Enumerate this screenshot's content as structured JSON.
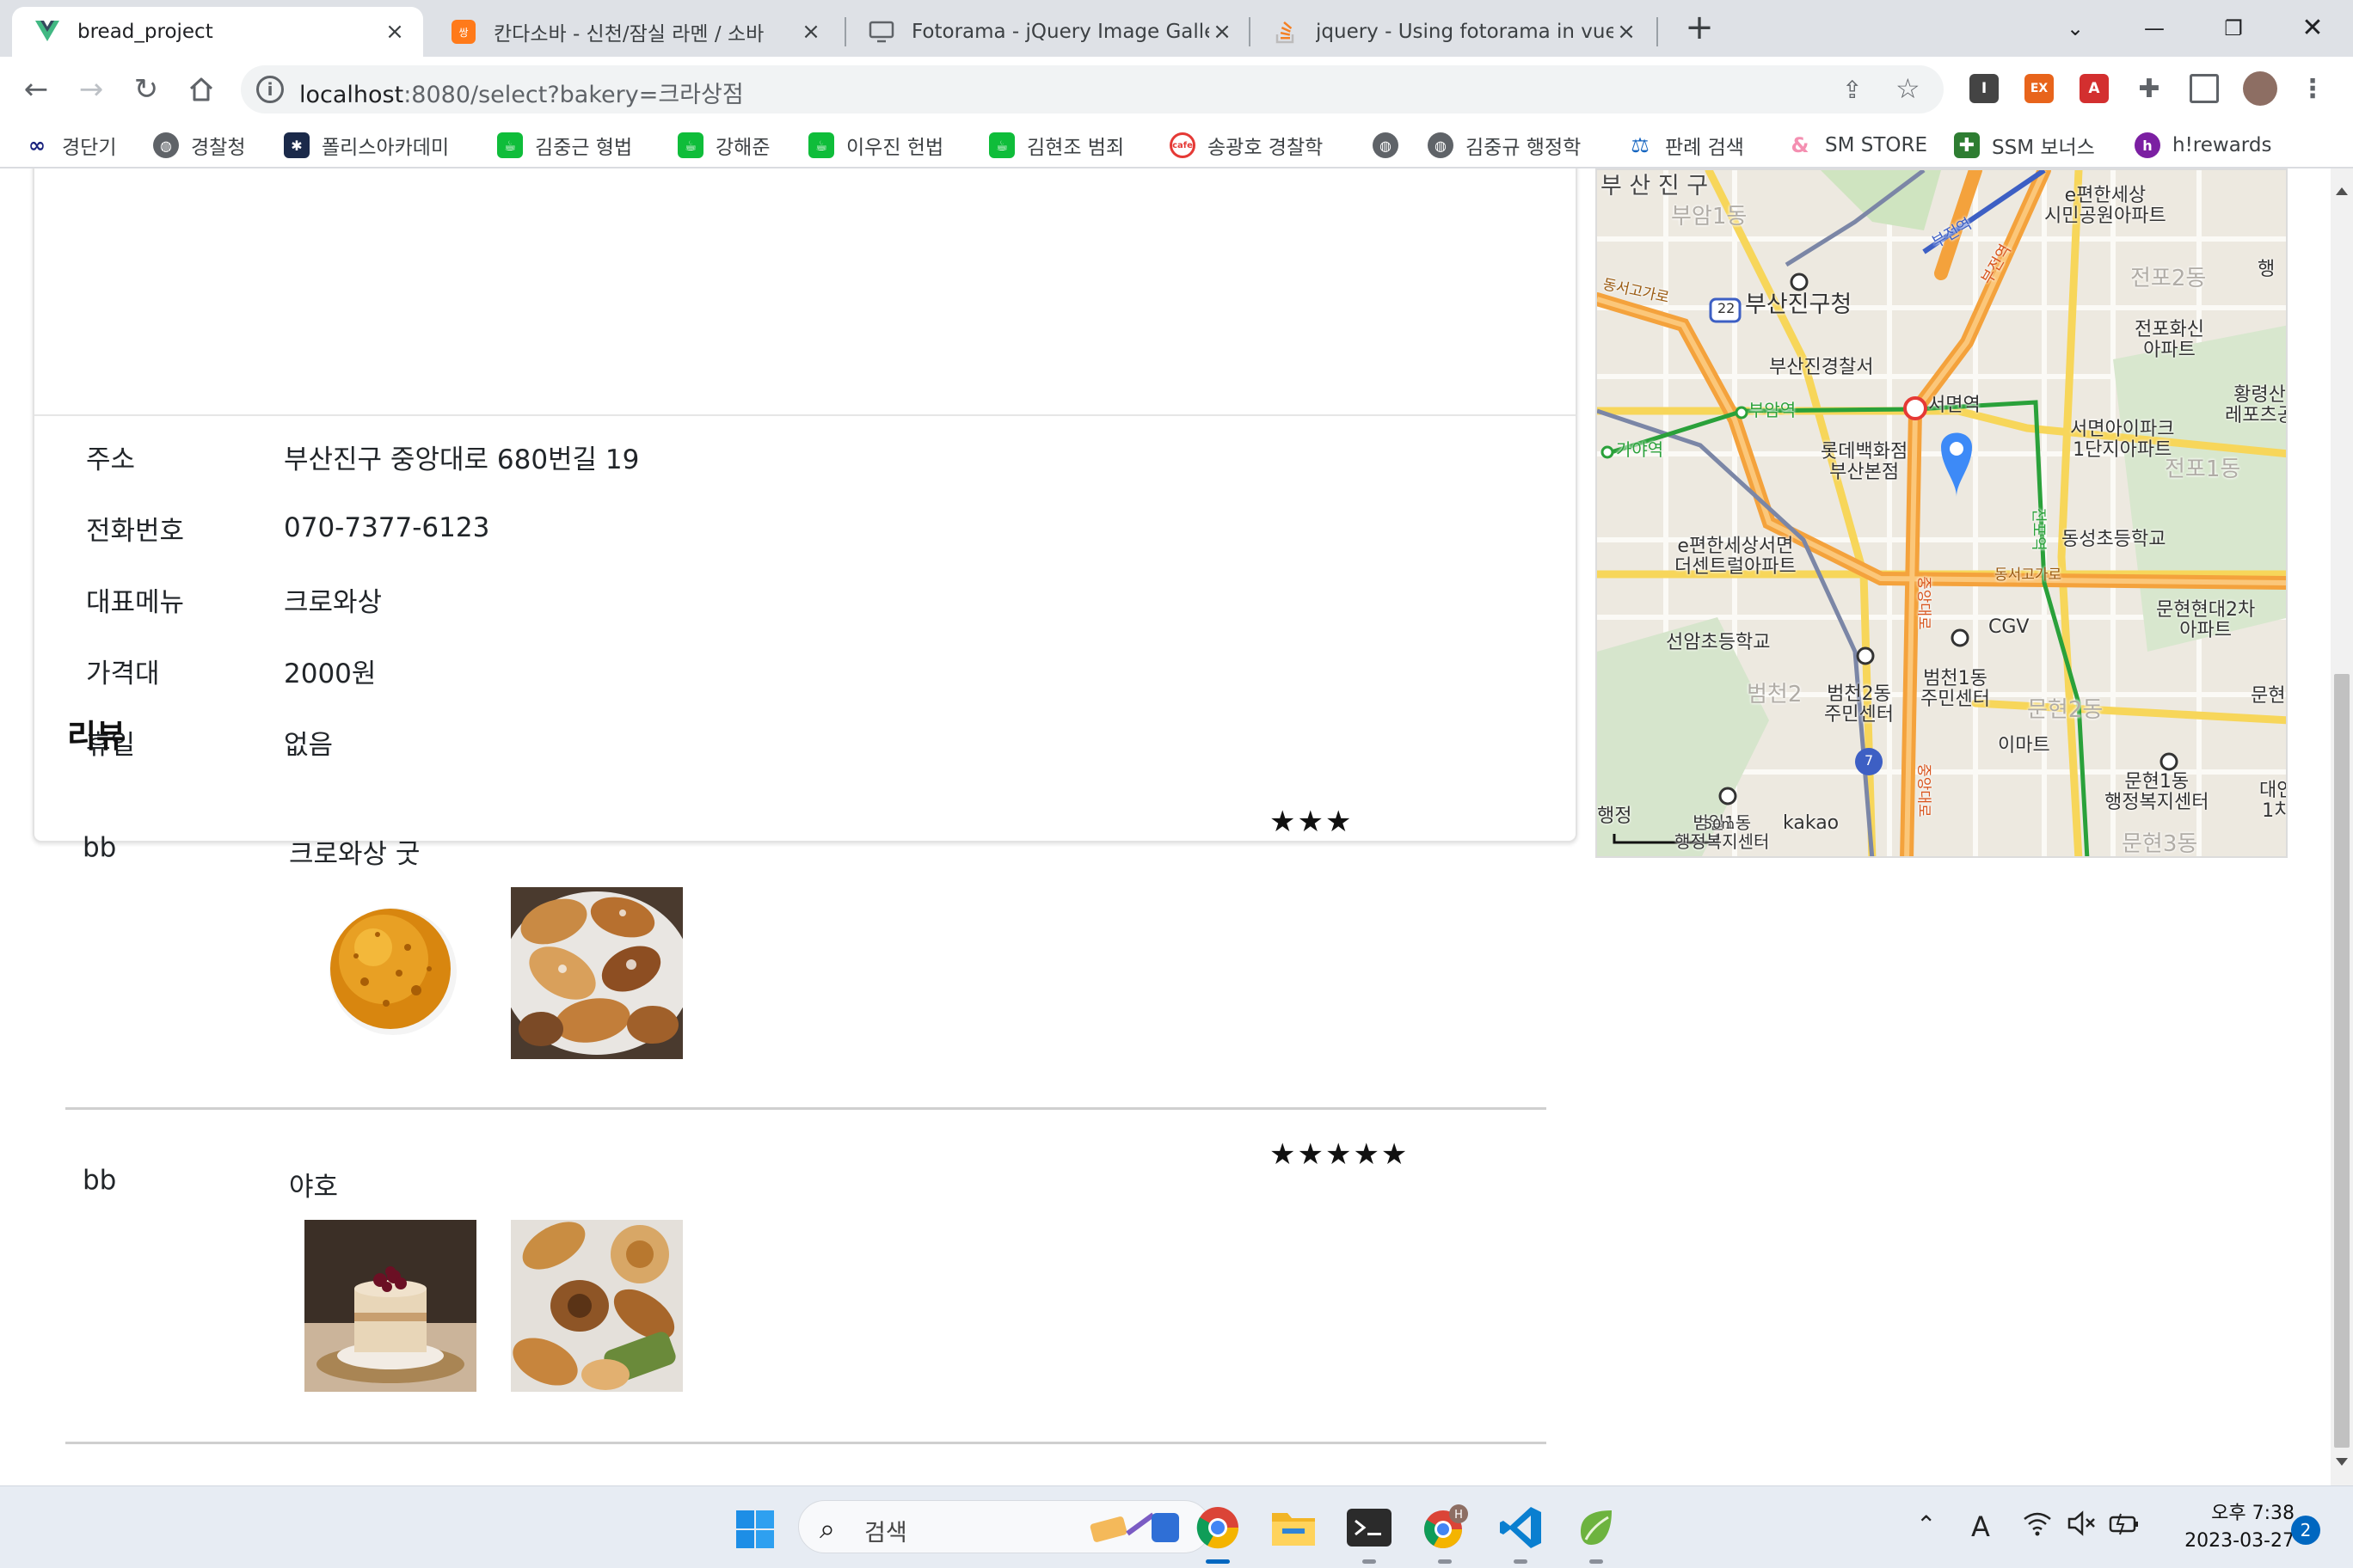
{
  "browser": {
    "tabs": [
      {
        "title": "bread_project",
        "active": true
      },
      {
        "title": "칸다소바 - 신천/잠실 라멘 / 소바",
        "active": false
      },
      {
        "title": "Fotorama - jQuery Image Galler",
        "active": false
      },
      {
        "title": "jquery - Using fotorama in vue",
        "active": false
      }
    ],
    "new_tab": "+",
    "url_host": "localhost",
    "url_rest": ":8080/select?bakery=크라상점",
    "bookmarks": [
      {
        "label": "경단기",
        "icon": "kyungdangi-icon",
        "color": "#1a237e"
      },
      {
        "label": "경찰청",
        "icon": "globe-icon",
        "color": "#5f6368"
      },
      {
        "label": "폴리스아카데미",
        "icon": "police-academy-icon",
        "color": "#1b2a4a"
      },
      {
        "label": "김중근 형법",
        "icon": "green-bookmark-icon",
        "color": "#0fbd3a"
      },
      {
        "label": "강해준",
        "icon": "green-bookmark-icon",
        "color": "#0fbd3a"
      },
      {
        "label": "이우진 헌법",
        "icon": "green-bookmark-icon",
        "color": "#0fbd3a"
      },
      {
        "label": "김현조 범죄",
        "icon": "green-bookmark-icon",
        "color": "#0fbd3a"
      },
      {
        "label": "송광호 경찰학",
        "icon": "cafe-icon",
        "color": "#e53935"
      },
      {
        "label": "",
        "icon": "globe-icon",
        "color": "#5f6368"
      },
      {
        "label": "김중규 행정학",
        "icon": "globe-icon",
        "color": "#5f6368"
      },
      {
        "label": "판례 검색",
        "icon": "law-icon",
        "color": "#1565c0"
      },
      {
        "label": "SM STORE",
        "icon": "sm-store-icon",
        "color": "#f48fb1"
      },
      {
        "label": "SSM 보너스",
        "icon": "ssm-icon",
        "color": "#2e7d32"
      },
      {
        "label": "h!rewards",
        "icon": "hrewards-icon",
        "color": "#7b1fa2"
      }
    ]
  },
  "bakery": {
    "fields": [
      {
        "label": "주소",
        "value": "부산진구 중앙대로 680번길 19"
      },
      {
        "label": "전화번호",
        "value": "070-7377-6123"
      },
      {
        "label": "대표메뉴",
        "value": "크로와상"
      },
      {
        "label": "가격대",
        "value": "2000원"
      },
      {
        "label": "휴일",
        "value": "없음"
      }
    ]
  },
  "reviews": {
    "title": "리뷰",
    "items": [
      {
        "author": "bb",
        "text": "크로와상 굿",
        "stars": "★★★",
        "rating": 3,
        "photos": [
          "round-pastry-photo",
          "croissant-platter-photo"
        ]
      },
      {
        "author": "bb",
        "text": "야호",
        "stars": "★★★★★",
        "rating": 5,
        "photos": [
          "mini-cake-photo",
          "pastry-assortment-photo"
        ]
      }
    ]
  },
  "map": {
    "labels": {
      "busanjin_gu": "부 산 진 구",
      "ehyeonhan_park": "e편한세상\n시민공원아파트",
      "busanjin_office": "부산진구청",
      "busanjin_police": "부산진경찰서",
      "seomyeon_station": "서면역",
      "buam_station": "부암역",
      "gaya_station": "가야역",
      "lotte": "롯데백화점\n부산본점",
      "jeonpo_apt": "전포화신\n아파트",
      "seomyeon_ipark": "서면아이파크\n1단지아파트",
      "hwangnyeong": "황령산\n레포츠공",
      "dongseong_school": "동성초등학교",
      "ehyeonhan_central": "e편한세상서면\n더센트럴아파트",
      "cgv": "CGV",
      "munhyeon_hyundai": "문현현대2차\n아파트",
      "seonam_school": "선암초등학교",
      "beomcheon2": "범천2동\n주민센터",
      "beomcheon1": "범천1동\n주민센터",
      "emart": "이마트",
      "munhyeon1": "문현1동\n행정복지센터",
      "beomil": "범일1동\n행정복지센터",
      "kakao": "kakao",
      "scale": "50m",
      "haeng": "행정",
      "munhyeon_edge": "문현",
      "daeyeon_edge": "대연\n1치",
      "route22": "22",
      "route7": "7",
      "buam_faint": "부암1동",
      "jeonpo_faint": "전포2동",
      "beomcheon_faint": "범천2",
      "munhyeon_faint": "문현2동",
      "munhyeon3_faint": "문현3동",
      "jeonpo1_faint": "전포1동",
      "dongseo_road": "동서고가로",
      "dongseo_road2": "동서고가로",
      "jungang_road": "중앙대로",
      "jungang_road2": "중앙대로",
      "bujeon": "부전역",
      "bujeon2": "부전역",
      "jeonpo_st": "전포역",
      "haeng_right": "행"
    }
  },
  "taskbar": {
    "search_label": "검색",
    "clock_time": "오후 7:38",
    "clock_date": "2023-03-27",
    "notifications": "2",
    "ime": "A"
  }
}
